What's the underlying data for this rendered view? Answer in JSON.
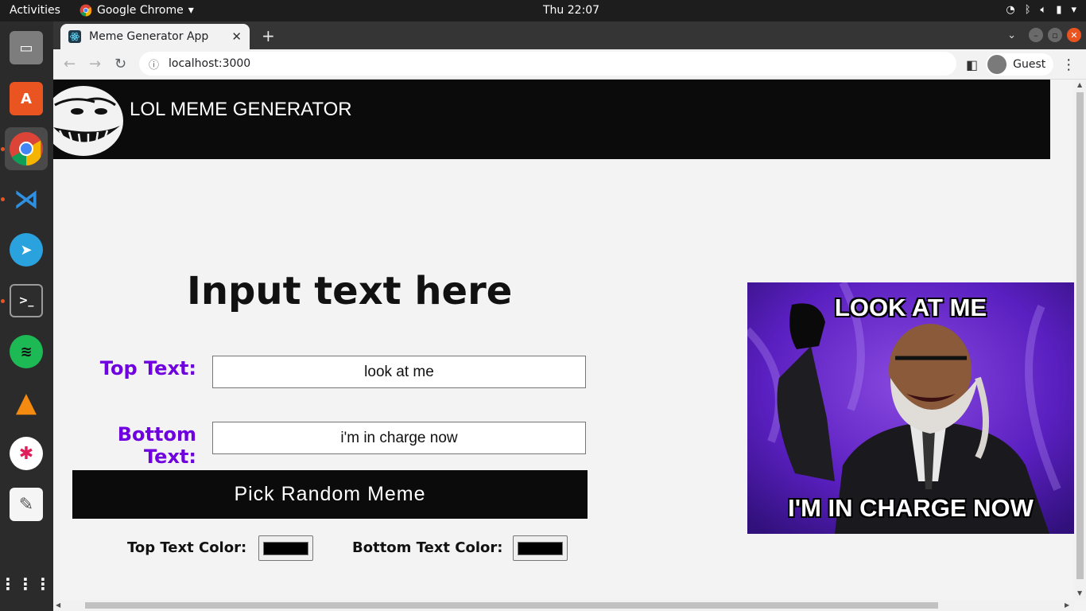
{
  "system": {
    "activities": "Activities",
    "app_name": "Google Chrome",
    "clock": "Thu 22:07"
  },
  "browser": {
    "tab_title": "Meme Generator App",
    "url": "localhost:3000",
    "profile_label": "Guest"
  },
  "page": {
    "header_title": "LOL MEME GENERATOR",
    "heading": "Input text here",
    "top_text_label": "Top Text:",
    "top_text_value": "look at me",
    "bottom_text_label": "Bottom Text:",
    "bottom_text_value": "i'm in charge now",
    "random_button": "Pick Random Meme",
    "top_color_label": "Top Text Color:",
    "top_color_value": "#000000",
    "bottom_color_label": "Bottom Text Color:",
    "bottom_color_value": "#000000",
    "meme_top_caption": "LOOK AT ME",
    "meme_bottom_caption": "I'M IN CHARGE NOW"
  },
  "colors": {
    "label_purple": "#6f00e0",
    "header_bg": "#0b0b0b",
    "accent_orange": "#e95420"
  }
}
